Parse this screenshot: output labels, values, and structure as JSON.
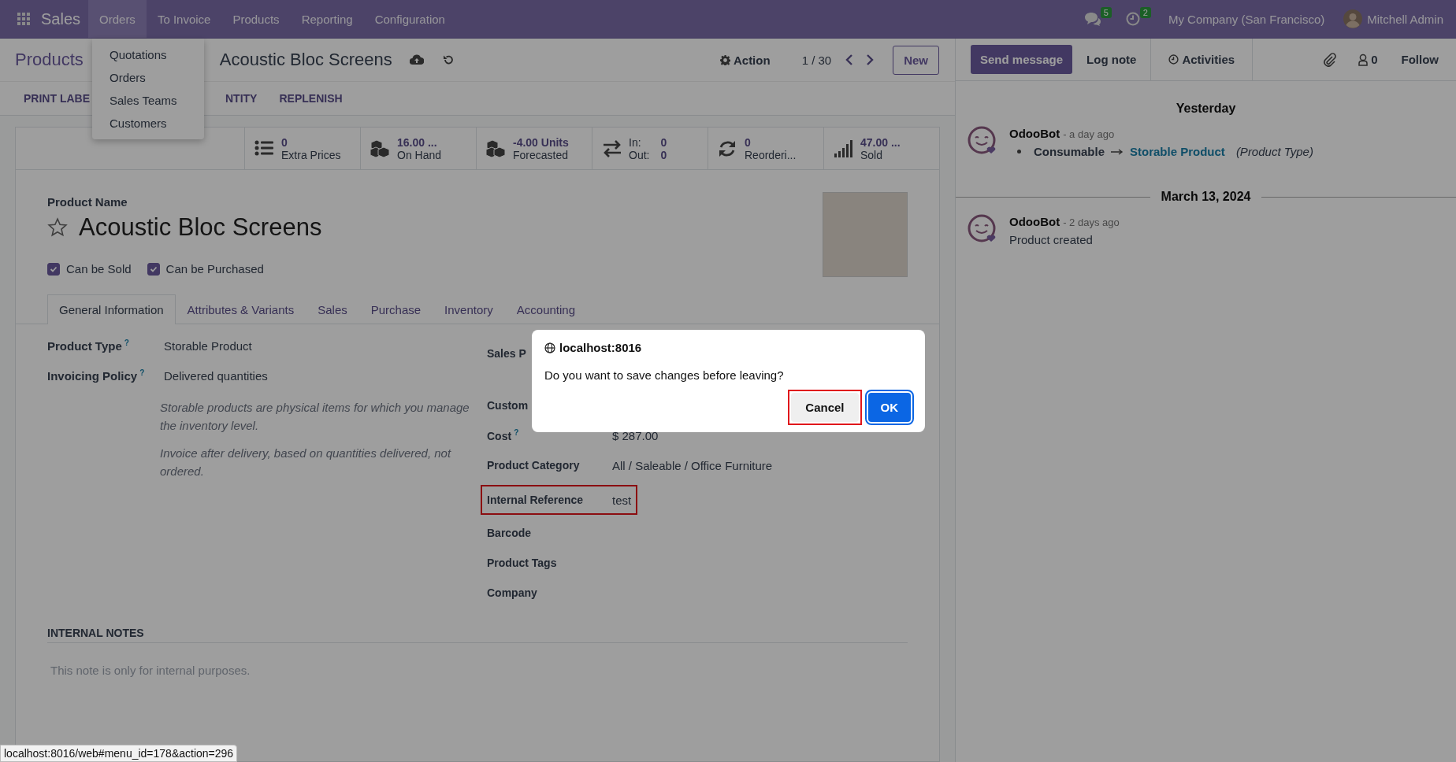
{
  "navbar": {
    "app_name": "Sales",
    "menu": [
      {
        "label": "Orders",
        "selected": true
      },
      {
        "label": "To Invoice",
        "selected": false
      },
      {
        "label": "Products",
        "selected": false
      },
      {
        "label": "Reporting",
        "selected": false
      },
      {
        "label": "Configuration",
        "selected": false
      }
    ],
    "messages_badge": "5",
    "activities_badge": "2",
    "company": "My Company (San Francisco)",
    "user": "Mitchell Admin"
  },
  "orders_menu": {
    "items": [
      "Quotations",
      "Orders",
      "Sales Teams",
      "Customers"
    ]
  },
  "control_panel": {
    "breadcrumb_parent": "Products",
    "record_name": "Acoustic Bloc Screens",
    "action": "Action",
    "pager": "1 / 30",
    "new_button": "New"
  },
  "action_buttons": [
    "PRINT LABE",
    "NTITY",
    "REPLENISH"
  ],
  "stat_buttons": [
    {
      "kind": "stat",
      "value": "0",
      "label": "Extra Prices"
    },
    {
      "kind": "stat",
      "value": "16.00 ...",
      "label": "On Hand"
    },
    {
      "kind": "stat",
      "value": "-4.00 Units",
      "label": "Forecasted"
    },
    {
      "kind": "inout",
      "in_label": "In:",
      "in_value": "0",
      "out_label": "Out:",
      "out_value": "0"
    },
    {
      "kind": "stat",
      "value": "0",
      "label": "Reorderi..."
    },
    {
      "kind": "stat",
      "value": "47.00 ...",
      "label": "Sold"
    }
  ],
  "product": {
    "name_label": "Product Name",
    "name": "Acoustic Bloc Screens",
    "favorite": false,
    "checkboxes": [
      {
        "label": "Can be Sold",
        "checked": true
      },
      {
        "label": "Can be Purchased",
        "checked": true
      }
    ]
  },
  "tabs": [
    {
      "label": "General Information",
      "selected": true
    },
    {
      "label": "Attributes & Variants",
      "selected": false
    },
    {
      "label": "Sales",
      "selected": false
    },
    {
      "label": "Purchase",
      "selected": false
    },
    {
      "label": "Inventory",
      "selected": false
    },
    {
      "label": "Accounting",
      "selected": false
    }
  ],
  "left_fields": [
    {
      "label": "Product Type",
      "help": "?",
      "value": "Storable Product"
    },
    {
      "label": "Invoicing Policy",
      "help": "?",
      "value": "Delivered quantities"
    }
  ],
  "hints": [
    "Storable products are physical items for which you manage the inventory level.",
    "Invoice after delivery, based on quantities delivered, not ordered."
  ],
  "right_fields": [
    {
      "label": "Sales P",
      "highlighted": false
    },
    {
      "label": "Custom",
      "highlighted": false
    },
    {
      "label": "Cost",
      "help": "?",
      "value": "$ 287.00",
      "highlighted": false
    },
    {
      "label": "Product Category",
      "value": "All / Saleable / Office Furniture",
      "highlighted": false
    },
    {
      "label": "Internal Reference",
      "value": "test",
      "highlighted": true
    },
    {
      "label": "Barcode",
      "highlighted": false
    },
    {
      "label": "Product Tags",
      "highlighted": false
    },
    {
      "label": "Company",
      "highlighted": false
    }
  ],
  "internal_notes": {
    "heading": "INTERNAL NOTES",
    "placeholder": "This note is only for internal purposes."
  },
  "chatter": {
    "send_message": "Send message",
    "log_note": "Log note",
    "activities": "Activities",
    "followers_count": "0",
    "follow": "Follow",
    "groups": [
      {
        "date": "Yesterday",
        "messages": [
          {
            "author": "OdooBot",
            "time": "- a day ago",
            "change": {
              "old": "Consumable",
              "new": "Storable Product",
              "field": "(Product Type)"
            }
          }
        ]
      },
      {
        "date": "March 13, 2024",
        "messages": [
          {
            "author": "OdooBot",
            "time": "- 2 days ago",
            "body": "Product created"
          }
        ]
      }
    ]
  },
  "dialog": {
    "origin": "localhost:8016",
    "message": "Do you want to save changes before leaving?",
    "buttons": [
      {
        "label": "Cancel",
        "kind": "secondary",
        "highlighted": true
      },
      {
        "label": "OK",
        "kind": "primary",
        "highlighted": false
      }
    ]
  },
  "status_url": "localhost:8016/web#menu_id=178&action=296"
}
